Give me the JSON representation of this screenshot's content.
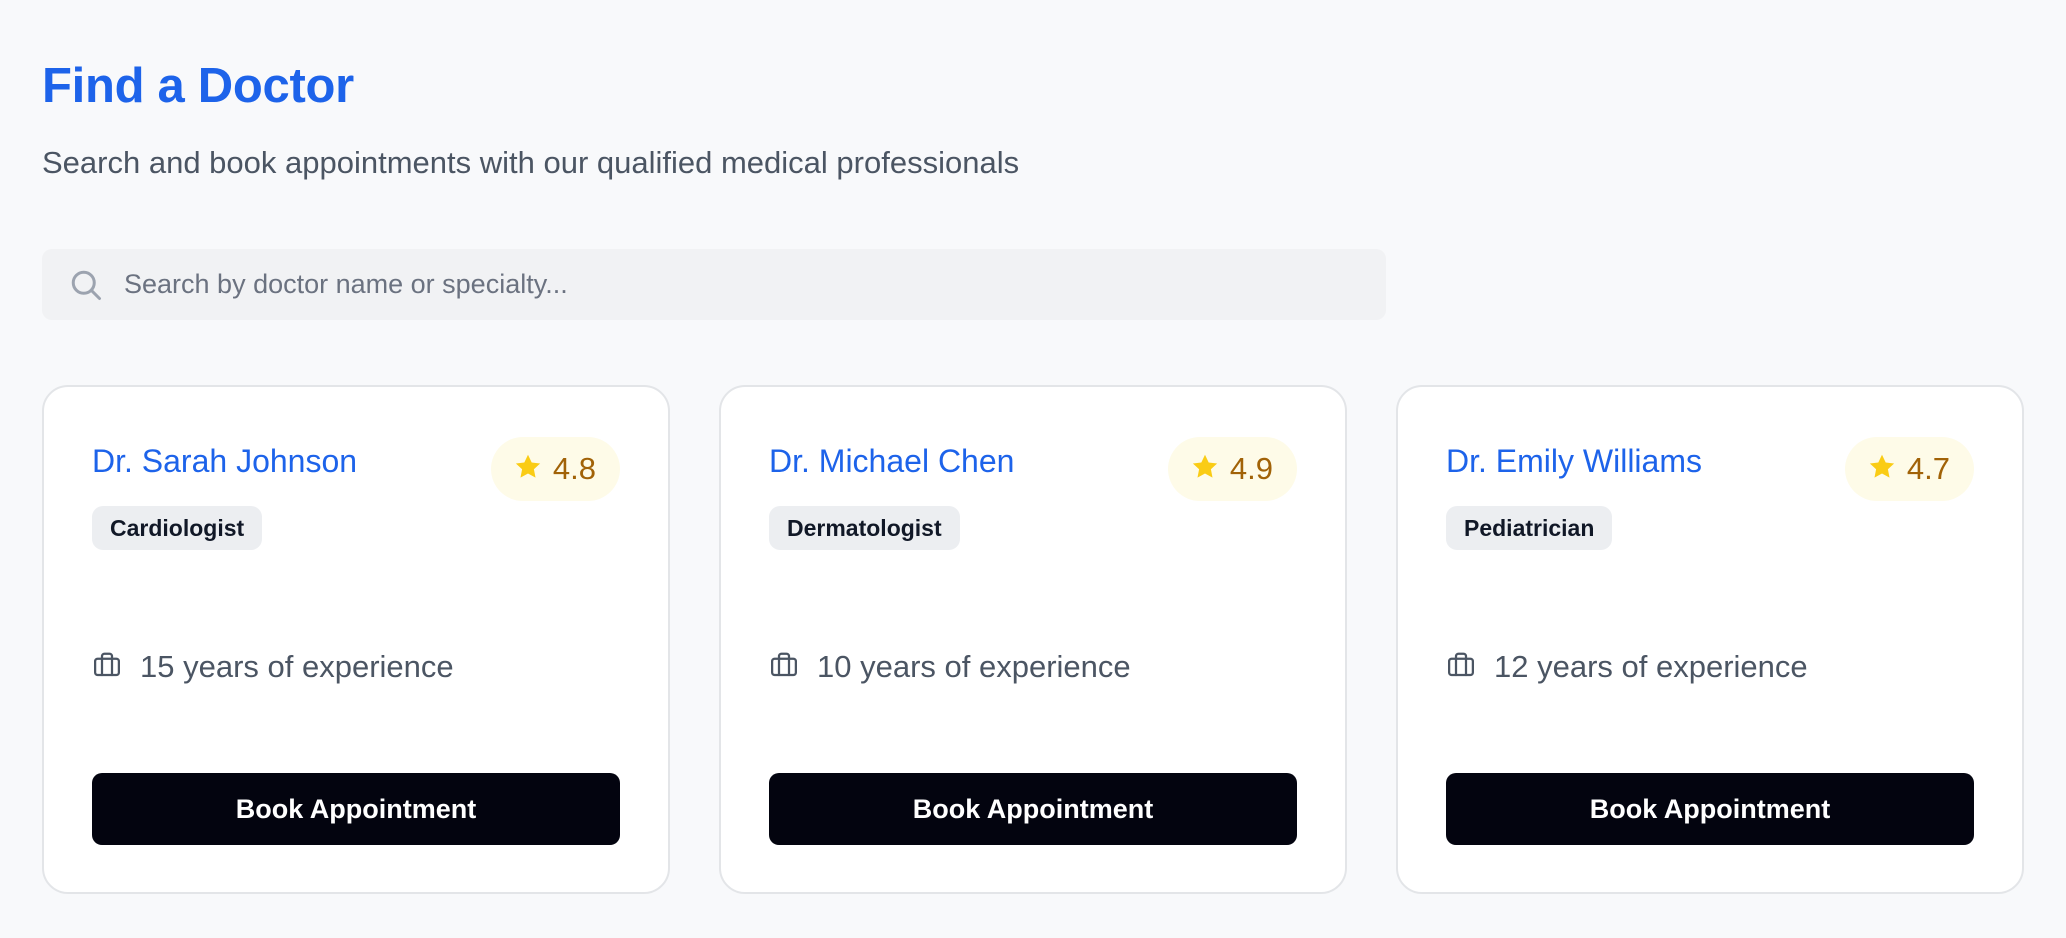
{
  "header": {
    "title": "Find a Doctor",
    "subtitle": "Search and book appointments with our qualified medical professionals"
  },
  "search": {
    "placeholder": "Search by doctor name or specialty...",
    "value": "",
    "icon": "search-icon"
  },
  "doctors": [
    {
      "name": "Dr. Sarah Johnson",
      "rating": "4.8",
      "specialty": "Cardiologist",
      "experience": "15 years of experience",
      "button_label": "Book Appointment"
    },
    {
      "name": "Dr. Michael Chen",
      "rating": "4.9",
      "specialty": "Dermatologist",
      "experience": "10 years of experience",
      "button_label": "Book Appointment"
    },
    {
      "name": "Dr. Emily Williams",
      "rating": "4.7",
      "specialty": "Pediatrician",
      "experience": "12 years of experience",
      "button_label": "Book Appointment"
    }
  ],
  "icons": {
    "rating": "star-icon",
    "experience": "briefcase-icon"
  },
  "colors": {
    "accent": "#1d63ea",
    "star": "#facc15",
    "rating_text": "#a16207",
    "rating_bg": "#fefbe8",
    "button_bg": "#03040f",
    "badge_bg": "#eceef1"
  }
}
